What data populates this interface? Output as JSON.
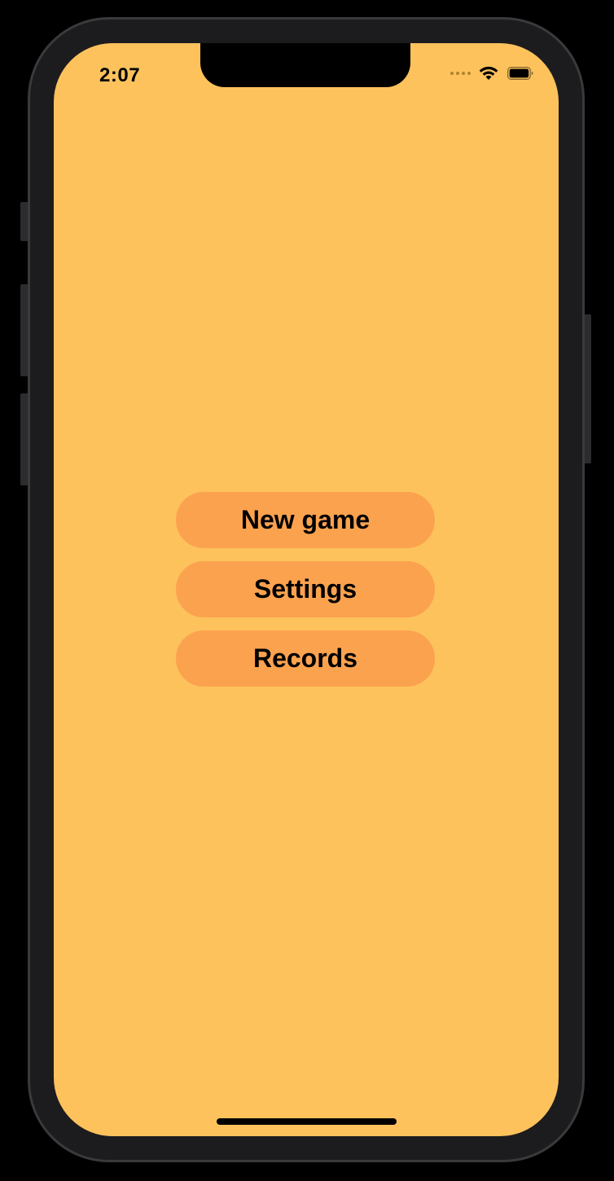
{
  "status_bar": {
    "time": "2:07",
    "icons": [
      "cellular-signal-icon",
      "wifi-icon",
      "battery-icon"
    ]
  },
  "menu": {
    "new_game_label": "New game",
    "settings_label": "Settings",
    "records_label": "Records"
  },
  "colors": {
    "background": "#fdc25c",
    "button": "#fba24f",
    "text": "#000000"
  }
}
